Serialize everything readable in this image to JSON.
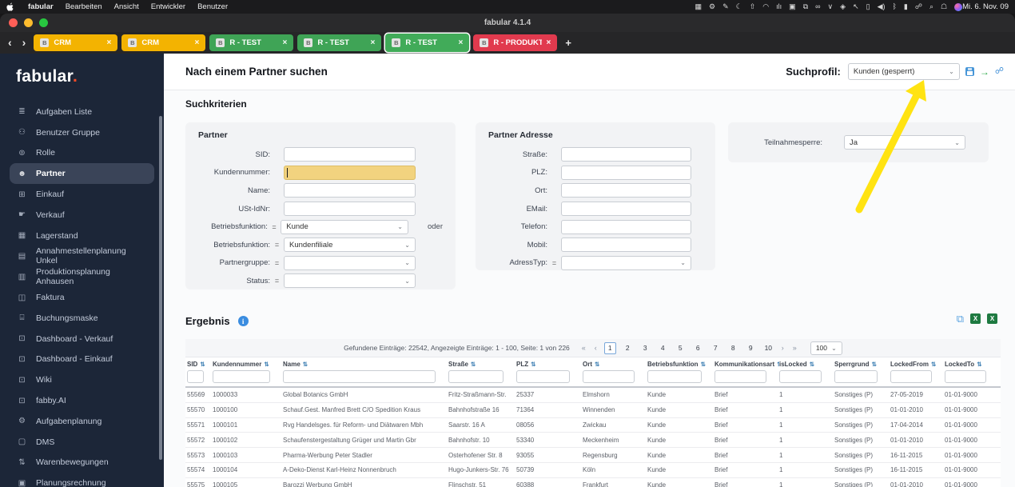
{
  "menubar": {
    "items": [
      "fabular",
      "Bearbeiten",
      "Ansicht",
      "Entwickler",
      "Benutzer"
    ],
    "status_icons": [
      {
        "name": "grid-icon",
        "glyph": "▦"
      },
      {
        "name": "settings-icon",
        "glyph": "⚙"
      },
      {
        "name": "pencil-icon",
        "glyph": "✎"
      },
      {
        "name": "moon-icon",
        "glyph": "☾"
      },
      {
        "name": "upload-icon",
        "glyph": "⇧"
      },
      {
        "name": "creative-cloud-icon",
        "glyph": "◠"
      },
      {
        "name": "waveform-icon",
        "glyph": "ılı"
      },
      {
        "name": "box-icon",
        "glyph": "▣"
      },
      {
        "name": "windows-icon",
        "glyph": "⧉"
      },
      {
        "name": "meta-icon",
        "glyph": "∞"
      },
      {
        "name": "chevron-down-icon",
        "glyph": "∨"
      },
      {
        "name": "diamond-icon",
        "glyph": "◈"
      },
      {
        "name": "cursor-icon",
        "glyph": "↖"
      },
      {
        "name": "document-icon",
        "glyph": "▯"
      },
      {
        "name": "volume-icon",
        "glyph": "◀)"
      },
      {
        "name": "bluetooth-icon",
        "glyph": "ᛒ"
      },
      {
        "name": "battery-icon",
        "glyph": "▮"
      },
      {
        "name": "link-icon",
        "glyph": "☍"
      },
      {
        "name": "search-icon",
        "glyph": "⌕"
      },
      {
        "name": "user-switch-icon",
        "glyph": "☖"
      },
      {
        "name": "siri-icon",
        "glyph": ""
      }
    ],
    "clock": "Mi. 6. Nov. 09"
  },
  "window": {
    "title": "fabular 4.1.4",
    "back": "‹",
    "forward": "›"
  },
  "tabbar": {
    "close_glyph": "×",
    "new_tab": "+",
    "tabs": [
      {
        "label": "CRM",
        "badge": "B",
        "color": "#f3b301",
        "active": false
      },
      {
        "label": "CRM",
        "badge": "B",
        "color": "#f3b301",
        "active": false
      },
      {
        "label": "R - TEST",
        "badge": "B",
        "color": "#3fa456",
        "active": false
      },
      {
        "label": "R - TEST",
        "badge": "B",
        "color": "#3fa456",
        "active": false
      },
      {
        "label": "R - TEST",
        "badge": "B",
        "color": "#41ab59",
        "active": true
      },
      {
        "label": "R - PRODUKTIV",
        "badge": "B",
        "color": "#e13a4e",
        "active": false
      }
    ]
  },
  "sidebar": {
    "logo": "fabular",
    "logo_dot": ".",
    "items": [
      {
        "icon": "≣",
        "label": "Aufgaben Liste",
        "active": false
      },
      {
        "icon": "⚇",
        "label": "Benutzer Gruppe",
        "active": false
      },
      {
        "icon": "⊚",
        "label": "Rolle",
        "active": false
      },
      {
        "icon": "☻",
        "label": "Partner",
        "active": true
      },
      {
        "icon": "⊞",
        "label": "Einkauf",
        "active": false
      },
      {
        "icon": "☛",
        "label": "Verkauf",
        "active": false
      },
      {
        "icon": "▦",
        "label": "Lagerstand",
        "active": false
      },
      {
        "icon": "▤",
        "label": "Annahmestellenplanung Unkel",
        "active": false
      },
      {
        "icon": "▥",
        "label": "Produktionsplanung Anhausen",
        "active": false
      },
      {
        "icon": "◫",
        "label": "Faktura",
        "active": false
      },
      {
        "icon": "⌸",
        "label": "Buchungsmaske",
        "active": false
      },
      {
        "icon": "⊡",
        "label": "Dashboard - Verkauf",
        "active": false
      },
      {
        "icon": "⊡",
        "label": "Dashboard - Einkauf",
        "active": false
      },
      {
        "icon": "⊡",
        "label": "Wiki",
        "active": false
      },
      {
        "icon": "⊡",
        "label": "fabby.AI",
        "active": false
      },
      {
        "icon": "⚙",
        "label": "Aufgabenplanung",
        "active": false
      },
      {
        "icon": "▢",
        "label": "DMS",
        "active": false
      },
      {
        "icon": "⇅",
        "label": "Warenbewegungen",
        "active": false
      },
      {
        "icon": "▣",
        "label": "Planungsrechnung",
        "active": false
      }
    ]
  },
  "header": {
    "title": "Nach einem Partner suchen",
    "profile_label": "Suchprofil:",
    "profile_value": "Kunden (gesperrt)",
    "run_glyph": "→",
    "unlink_glyph": "☍"
  },
  "search": {
    "title": "Suchkriterien",
    "partner": {
      "title": "Partner",
      "fields": [
        {
          "label": "SID:",
          "op": "",
          "type": "input",
          "value": "",
          "focused": false
        },
        {
          "label": "Kundennummer:",
          "op": "",
          "type": "input",
          "value": "",
          "focused": true
        },
        {
          "label": "Name:",
          "op": "",
          "type": "input",
          "value": "",
          "focused": false
        },
        {
          "label": "USt-IdNr:",
          "op": "",
          "type": "input",
          "value": "",
          "focused": false
        },
        {
          "label": "Betriebsfunktion:",
          "op": "=",
          "type": "select",
          "value": "Kunde",
          "suffix": "oder"
        },
        {
          "label": "Betriebsfunktion:",
          "op": "=",
          "type": "select",
          "value": "Kundenfiliale"
        },
        {
          "label": "Partnergruppe:",
          "op": "=",
          "type": "select",
          "value": ""
        },
        {
          "label": "Status:",
          "op": "=",
          "type": "select",
          "value": ""
        }
      ]
    },
    "address": {
      "title": "Partner Adresse",
      "fields": [
        {
          "label": "Straße:",
          "op": "",
          "type": "input",
          "value": "",
          "focused": false
        },
        {
          "label": "PLZ:",
          "op": "",
          "type": "input",
          "value": "",
          "focused": false
        },
        {
          "label": "Ort:",
          "op": "",
          "type": "input",
          "value": "",
          "focused": false
        },
        {
          "label": "EMail:",
          "op": "",
          "type": "input",
          "value": "",
          "focused": false
        },
        {
          "label": "Telefon:",
          "op": "",
          "type": "input",
          "value": "",
          "focused": false
        },
        {
          "label": "Mobil:",
          "op": "",
          "type": "input",
          "value": "",
          "focused": false
        },
        {
          "label": "AdressTyp:",
          "op": "=",
          "type": "select",
          "value": ""
        }
      ]
    },
    "misc": {
      "fields": [
        {
          "label": "Teilnahmesperre:",
          "op": "",
          "type": "select",
          "value": "Ja"
        }
      ]
    }
  },
  "results": {
    "title": "Ergebnis",
    "info_glyph": "i",
    "sort_glyph": "⇅",
    "summary": "Gefundene Einträge: 22542, Angezeigte Einträge: 1 - 100, Seite: 1 von 226",
    "pager": {
      "first": "«",
      "prev": "‹",
      "next": "›",
      "last": "»",
      "pages": [
        "1",
        "2",
        "3",
        "4",
        "5",
        "6",
        "7",
        "8",
        "9",
        "10"
      ],
      "active": "1",
      "page_size": "100"
    },
    "columns": [
      "SID",
      "Kundennummer",
      "Name",
      "Straße",
      "PLZ",
      "Ort",
      "Betriebsfunktion",
      "Kommunikationsart",
      "isLocked",
      "Sperrgrund",
      "LockedFrom",
      "LockedTo"
    ],
    "rows": [
      [
        "55569",
        "1000033",
        "Global Botanics GmbH",
        "Fritz-Straßmann-Str.",
        "25337",
        "Elmshorn",
        "Kunde",
        "Brief",
        "1",
        "Sonstiges (P)",
        "27-05-2019",
        "01-01-9000"
      ],
      [
        "55570",
        "1000100",
        "Schauf.Gest. Manfred Brett C/O Spedition Kraus",
        "Bahnhofstraße 16",
        "71364",
        "Winnenden",
        "Kunde",
        "Brief",
        "1",
        "Sonstiges (P)",
        "01-01-2010",
        "01-01-9000"
      ],
      [
        "55571",
        "1000101",
        "Rvg Handelsges. für Reform- und Diätwaren Mbh",
        "Saarstr. 16 A",
        "08056",
        "Zwickau",
        "Kunde",
        "Brief",
        "1",
        "Sonstiges (P)",
        "17-04-2014",
        "01-01-9000"
      ],
      [
        "55572",
        "1000102",
        "Schaufenstergestaltung Grüger und Martin Gbr",
        "Bahnhofstr. 10",
        "53340",
        "Meckenheim",
        "Kunde",
        "Brief",
        "1",
        "Sonstiges (P)",
        "01-01-2010",
        "01-01-9000"
      ],
      [
        "55573",
        "1000103",
        "Pharma-Werbung Peter Stadler",
        "Osterhofener Str. 8",
        "93055",
        "Regensburg",
        "Kunde",
        "Brief",
        "1",
        "Sonstiges (P)",
        "16-11-2015",
        "01-01-9000"
      ],
      [
        "55574",
        "1000104",
        "A-Deko-Dienst Karl-Heinz Nonnenbruch",
        "Hugo-Junkers-Str. 76",
        "50739",
        "Köln",
        "Kunde",
        "Brief",
        "1",
        "Sonstiges (P)",
        "16-11-2015",
        "01-01-9000"
      ],
      [
        "55575",
        "1000105",
        "Barozzi Werbung GmbH",
        "Flinschstr. 51",
        "60388",
        "Frankfurt",
        "Kunde",
        "Brief",
        "1",
        "Sonstiges (P)",
        "01-01-2010",
        "01-01-9000"
      ]
    ]
  },
  "annotation": {
    "arrow_color": "#ffe312"
  }
}
